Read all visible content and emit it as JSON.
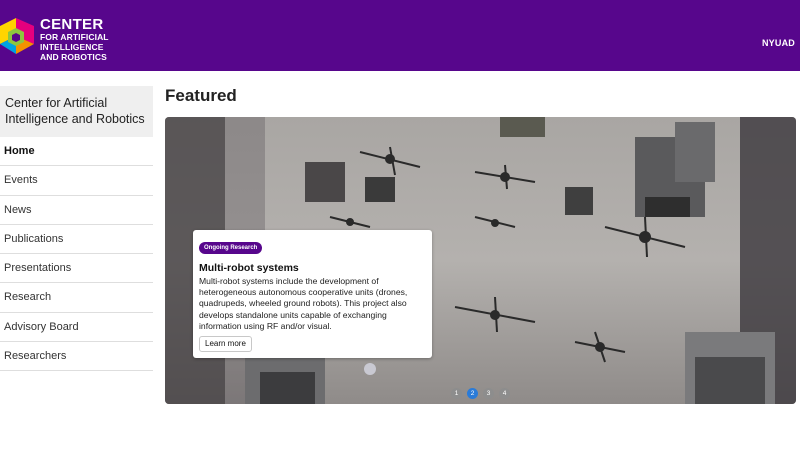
{
  "header": {
    "logo_line1": "CENTER",
    "logo_line2": "FOR ARTIFICIAL",
    "logo_line3": "INTELLIGENCE",
    "logo_line4": "AND ROBOTICS",
    "right_label": "NYUAD",
    "background_color": "#57068c"
  },
  "sidebar": {
    "title": "Center for Artificial Intelligence and Robotics",
    "items": [
      {
        "label": "Home",
        "active": true
      },
      {
        "label": "Events",
        "active": false
      },
      {
        "label": "News",
        "active": false
      },
      {
        "label": "Publications",
        "active": false
      },
      {
        "label": "Presentations",
        "active": false
      },
      {
        "label": "Research",
        "active": false
      },
      {
        "label": "Advisory Board",
        "active": false
      },
      {
        "label": "Researchers",
        "active": false
      }
    ]
  },
  "main": {
    "heading": "Featured",
    "carousel": {
      "image_description_icon": "robots-photo",
      "card": {
        "badge": "Ongoing Research",
        "title": "Multi-robot systems",
        "body": "Multi-robot systems include the development of heterogeneous autonomous cooperative units (drones, quadrupeds, wheeled ground robots). This project also develops standalone units capable of exchanging information using RF and/or visual.",
        "button": "Learn more"
      },
      "indicators": [
        "1",
        "2",
        "3",
        "4"
      ],
      "active_index": 1,
      "active_color": "#2a7bd8"
    }
  }
}
